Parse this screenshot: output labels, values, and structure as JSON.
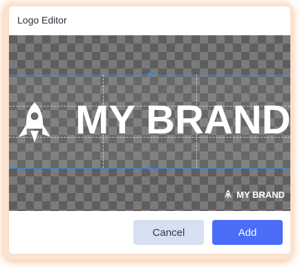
{
  "dialog": {
    "title": "Logo Editor"
  },
  "canvas": {
    "brand_text": "MY BRAND",
    "preview_text": "MY BRAND",
    "logo_icon": "rocket-icon",
    "checker_colors": [
      "#5e5e5e",
      "#7a7a7a"
    ],
    "guide_color": "#3d86d8"
  },
  "footer": {
    "cancel_label": "Cancel",
    "add_label": "Add",
    "accent_color": "#4a6cf6",
    "secondary_color": "#d7e0f0"
  }
}
